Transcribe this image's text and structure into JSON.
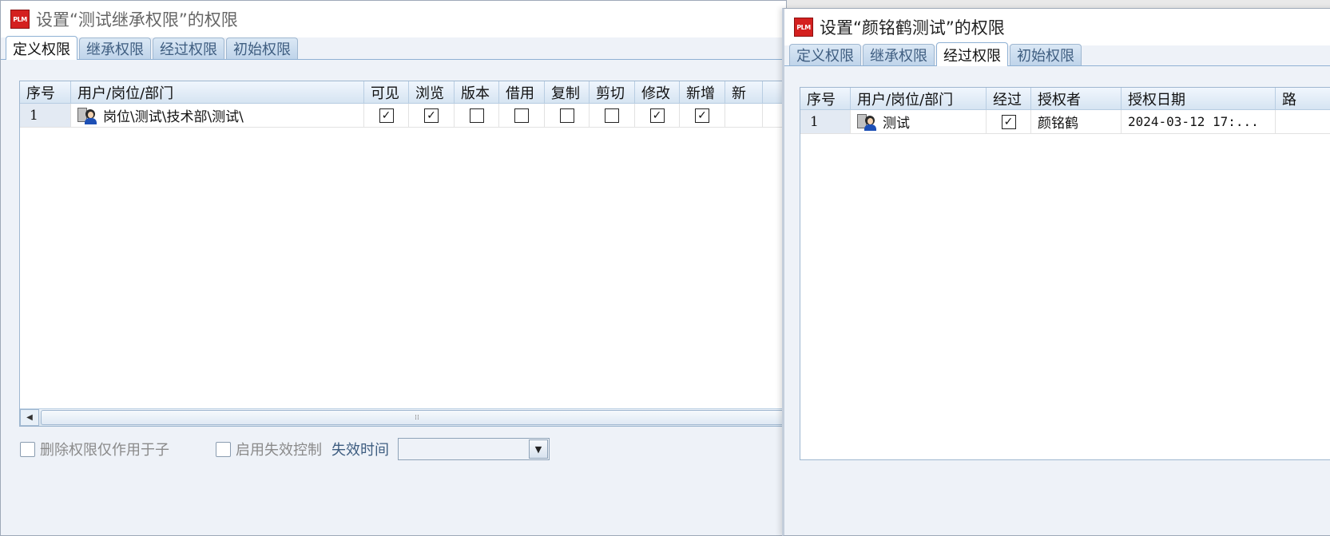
{
  "dialog1": {
    "title": "设置“测试继承权限”的权限",
    "tabs": [
      "定义权限",
      "继承权限",
      "经过权限",
      "初始权限"
    ],
    "active_tab": 0,
    "columns": [
      "序号",
      "用户/岗位/部门",
      "可见",
      "浏览",
      "版本",
      "借用",
      "复制",
      "剪切",
      "修改",
      "新增",
      "新"
    ],
    "rows": [
      {
        "num": "1",
        "name": "岗位\\测试\\技术部\\测试\\",
        "checks": [
          true,
          true,
          false,
          false,
          false,
          false,
          true,
          true
        ]
      }
    ],
    "options": {
      "delete_only_children": "删除权限仅作用于子",
      "enable_expire_control": "启用失效控制",
      "expire_time_label": "失效时间",
      "expire_time_value": ""
    }
  },
  "dialog2": {
    "title": "设置“颜铭鹤测试”的权限",
    "tabs": [
      "定义权限",
      "继承权限",
      "经过权限",
      "初始权限"
    ],
    "active_tab": 2,
    "columns": [
      "序号",
      "用户/岗位/部门",
      "经过",
      "授权者",
      "授权日期",
      "路"
    ],
    "rows": [
      {
        "num": "1",
        "name": "测试",
        "passed": true,
        "grantor": "颜铭鹤",
        "date": "2024-03-12 17:..."
      }
    ]
  },
  "icons": {
    "app_logo": "PLM",
    "check_mark": "✓"
  }
}
